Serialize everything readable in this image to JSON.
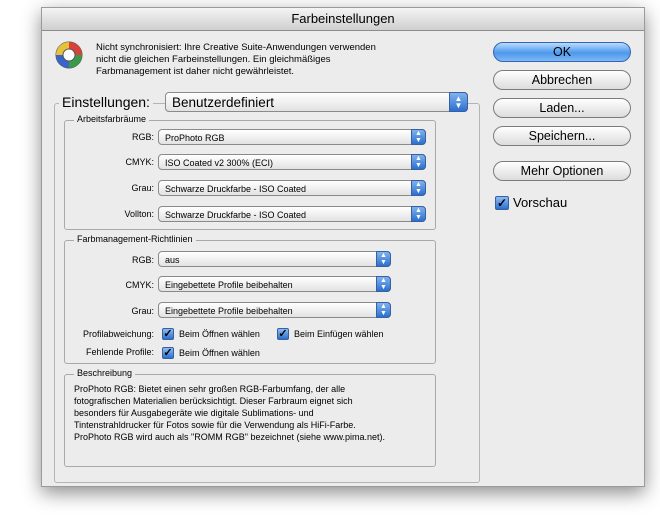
{
  "window": {
    "title": "Farbeinstellungen"
  },
  "message": {
    "line1": "Nicht synchronisiert: Ihre Creative Suite-Anwendungen verwenden",
    "line2": "nicht die gleichen Farbeinstellungen. Ein gleichmäßiges",
    "line3": "Farbmanagement ist daher nicht gewährleistet."
  },
  "settings": {
    "label": "Einstellungen:",
    "value": "Benutzerdefiniert"
  },
  "workspaces": {
    "title": "Arbeitsfarbräume",
    "rgb_label": "RGB:",
    "rgb_value": "ProPhoto RGB",
    "cmyk_label": "CMYK:",
    "cmyk_value": "ISO Coated v2 300% (ECI)",
    "gray_label": "Grau:",
    "gray_value": "Schwarze Druckfarbe - ISO Coated",
    "spot_label": "Vollton:",
    "spot_value": "Schwarze Druckfarbe - ISO Coated"
  },
  "policies": {
    "title": "Farbmanagement-Richtlinien",
    "rgb_label": "RGB:",
    "rgb_value": "aus",
    "cmyk_label": "CMYK:",
    "cmyk_value": "Eingebettete Profile beibehalten",
    "gray_label": "Grau:",
    "gray_value": "Eingebettete Profile beibehalten",
    "mismatch_label": "Profilabweichung:",
    "mismatch_open": "Beim Öffnen wählen",
    "mismatch_paste": "Beim Einfügen wählen",
    "missing_label": "Fehlende Profile:",
    "missing_open": "Beim Öffnen wählen"
  },
  "description": {
    "title": "Beschreibung",
    "line1": "ProPhoto RGB:  Bietet einen sehr großen RGB-Farbumfang, der alle",
    "line2": "fotografischen Materialien berücksichtigt. Dieser Farbraum eignet sich",
    "line3": "besonders für Ausgabegeräte wie digitale Sublimations- und",
    "line4": "Tintenstrahldrucker für Fotos sowie für die Verwendung als HiFi-Farbe.",
    "line5": "ProPhoto RGB wird auch als \"ROMM RGB\" bezeichnet (siehe www.pima.net)."
  },
  "buttons": {
    "ok": "OK",
    "cancel": "Abbrechen",
    "load": "Laden...",
    "save": "Speichern...",
    "more": "Mehr Optionen"
  },
  "preview": {
    "label": "Vorschau",
    "checked": true
  },
  "icons": {
    "checkmark": "✓",
    "popup_up": "▲",
    "popup_down": "▼"
  },
  "colors": {
    "accent": "#2c6fd0",
    "window_bg": "#ececec"
  }
}
